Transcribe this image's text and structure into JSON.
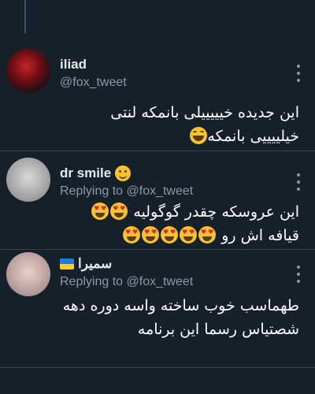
{
  "tweets": [
    {
      "name": "iliad",
      "handle": "@fox_tweet",
      "lines": [
        "این جدیده خیییییلی بانمکه لنتی",
        "خیلییییی بانمکه"
      ],
      "avatar_icon": "blurred-red-avatar"
    },
    {
      "name": "dr smile",
      "reply_prefix": "Replying to ",
      "reply_handle": "@fox_tweet",
      "lines": [
        "این عروسکه چقدر گوگولیه",
        "قیافه اش رو"
      ],
      "avatar_icon": "blurred-grey-avatar"
    },
    {
      "name": "سمیرا",
      "reply_prefix": "Replying to ",
      "reply_handle": "@fox_tweet",
      "lines": [
        "طهماسب خوب ساخته واسه دوره دهه",
        "شصتیاس رسما این برنامه"
      ],
      "avatar_icon": "blurred-pink-avatar"
    }
  ],
  "colors": {
    "background": "#15202b",
    "secondary_text": "#8b98a5",
    "divider": "#38444d"
  }
}
